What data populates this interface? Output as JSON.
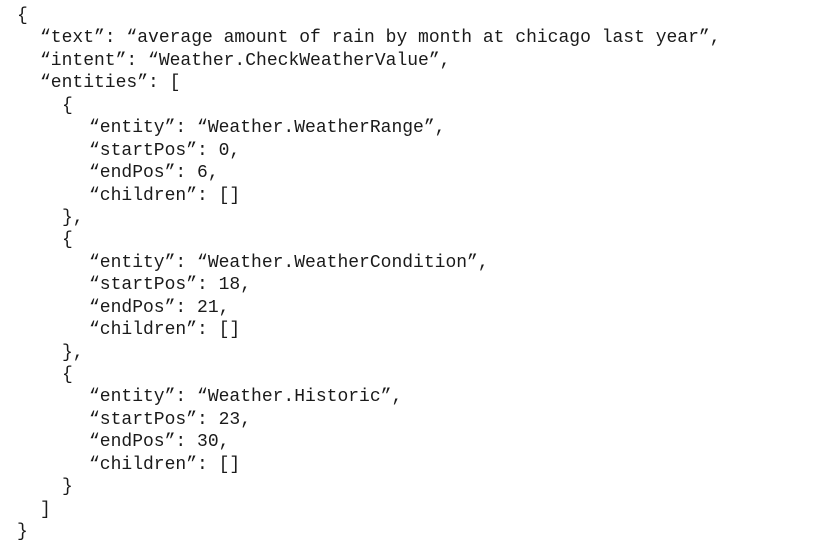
{
  "document": {
    "lines": [
      "{",
      "“text”: “average amount of rain by month at chicago last year”,",
      "“intent”: “Weather.CheckWeatherValue”,",
      "“entities”: [",
      "{",
      "“entity”: “Weather.WeatherRange”,",
      "“startPos”: 0,",
      "“endPos”: 6,",
      "“children”: []",
      "},",
      "{",
      "“entity”: “Weather.WeatherCondition”,",
      "“startPos”: 18,",
      "“endPos”: 21,",
      "“children”: []",
      "},",
      "{",
      "“entity”: “Weather.Historic”,",
      "“startPos”: 23,",
      "“endPos”: 30,",
      "“children”: []",
      "}",
      "]",
      "}"
    ]
  }
}
